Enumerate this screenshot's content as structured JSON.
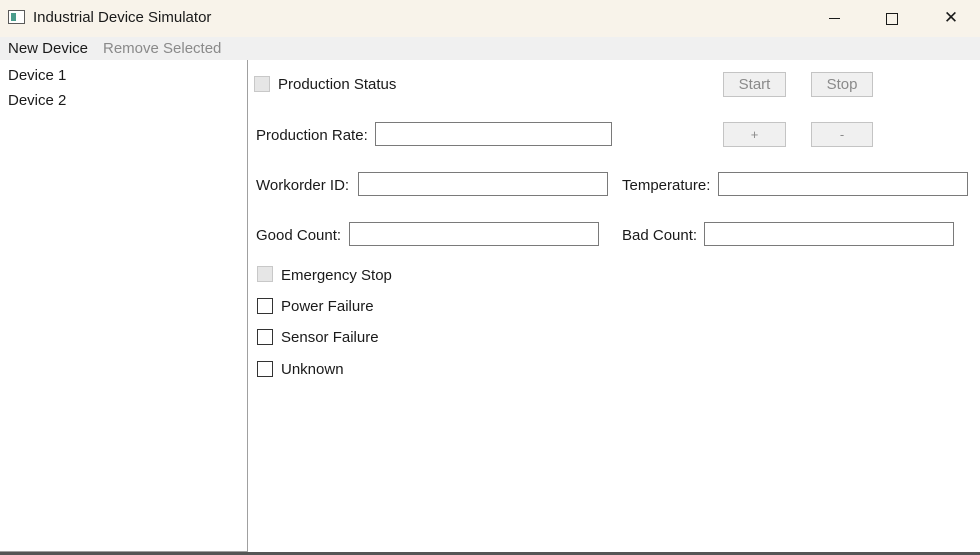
{
  "window": {
    "title": "Industrial Device Simulator",
    "icon": "app-window-icon",
    "controls": [
      "minimize-icon",
      "maximize-icon",
      "close-icon"
    ],
    "close_glyph": "✕"
  },
  "menu": {
    "new_device": "New Device",
    "remove_selected": "Remove Selected"
  },
  "devices": [
    "Device 1",
    "Device 2"
  ],
  "form": {
    "production_status": "Production Status",
    "start": "Start",
    "stop": "Stop",
    "production_rate": "Production Rate:",
    "plus": "+",
    "minus": "-",
    "workorder_id": "Workorder ID:",
    "temperature": "Temperature:",
    "good_count": "Good Count:",
    "bad_count": "Bad Count:",
    "emergency_stop": "Emergency Stop",
    "power_failure": "Power Failure",
    "sensor_failure": "Sensor Failure",
    "unknown": "Unknown",
    "values": {
      "production_rate": "",
      "workorder_id": "",
      "temperature": "",
      "good_count": "",
      "bad_count": ""
    }
  },
  "colors": {
    "titlebar": "#f8f3ea",
    "menubar": "#f0f0f0",
    "disabled_text": "#8a8a8a"
  }
}
